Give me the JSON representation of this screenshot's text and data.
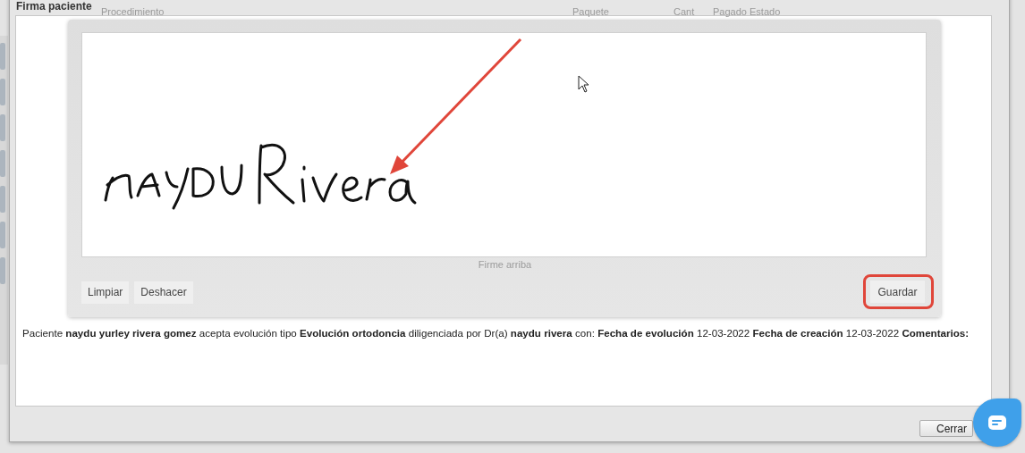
{
  "background_table": {
    "columns": [
      "Procedimiento",
      "Paquete",
      "Cant",
      "Pagado",
      "Estado"
    ]
  },
  "dialog": {
    "title": "Firma paciente",
    "signature_pad": {
      "hint": "Firme arriba",
      "buttons": [
        "Limpiar",
        "Deshacer"
      ],
      "save_button": {
        "label": "Guardar",
        "highlighted": true
      }
    },
    "consent_text": "Paciente **naydu yurley rivera gomez** acepta evolución tipo **Evolución ortodoncia** diligenciada por Dr(a) **naydu rivera** con: **Fecha de evolución** 12-03-2022 **Fecha de creación** 12-03-2022 **Comentarios:**",
    "close_button": "Cerrar"
  }
}
